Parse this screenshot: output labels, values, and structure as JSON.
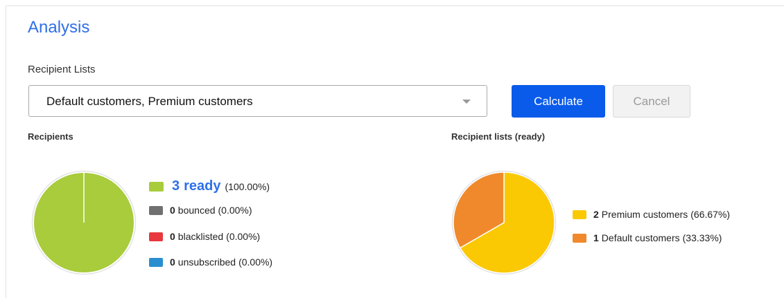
{
  "page": {
    "title": "Analysis"
  },
  "recipient_lists": {
    "label": "Recipient Lists",
    "selected": "Default customers, Premium customers",
    "calculate_label": "Calculate",
    "cancel_label": "Cancel"
  },
  "recipients": {
    "heading": "Recipients",
    "items": [
      {
        "count": "3",
        "label": "ready",
        "percent": "(100.00%)",
        "value": 3,
        "color": "#a8cc3c"
      },
      {
        "count": "0",
        "label": "bounced",
        "percent": "(0.00%)",
        "value": 0,
        "color": "#707070"
      },
      {
        "count": "0",
        "label": "blacklisted",
        "percent": "(0.00%)",
        "value": 0,
        "color": "#e8383d"
      },
      {
        "count": "0",
        "label": "unsubscribed",
        "percent": "(0.00%)",
        "value": 0,
        "color": "#2a8fd0"
      }
    ]
  },
  "lists_ready": {
    "heading": "Recipient lists (ready)",
    "items": [
      {
        "count": "2",
        "label": "Premium customers",
        "percent": "(66.67%)",
        "value": 2,
        "color": "#fbc904"
      },
      {
        "count": "1",
        "label": "Default customers",
        "percent": "(33.33%)",
        "value": 1,
        "color": "#f0892b"
      }
    ]
  }
}
